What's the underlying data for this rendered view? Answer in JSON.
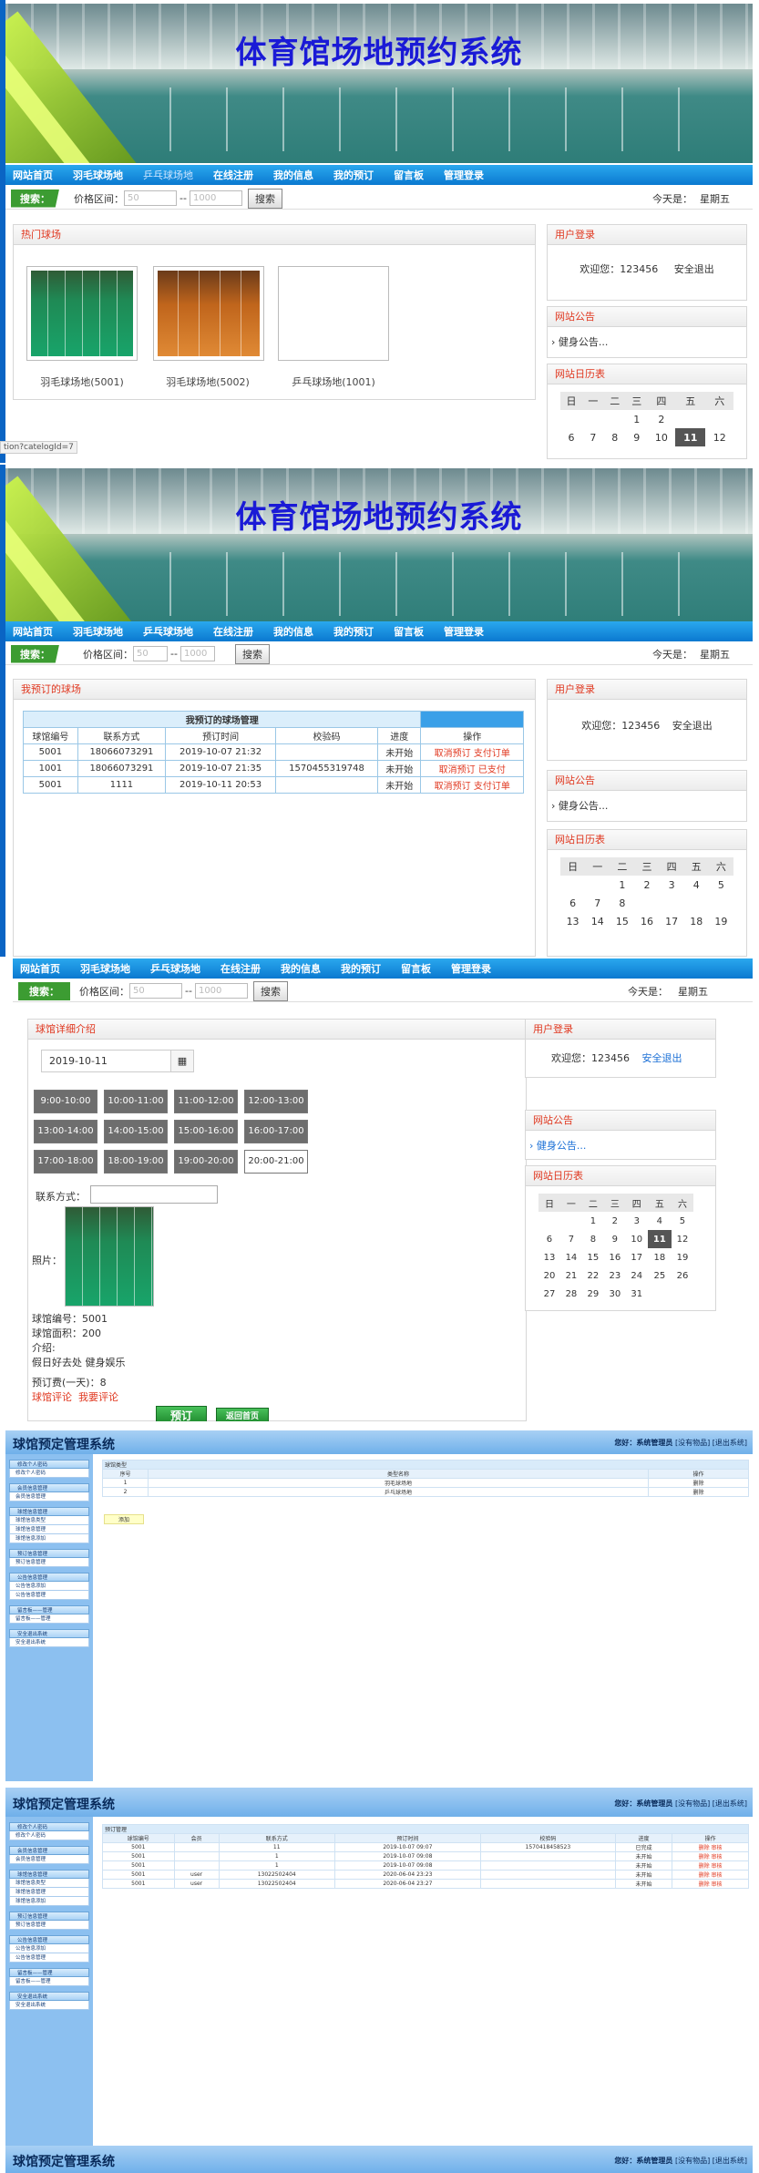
{
  "site_title": "体育馆场地预约系统",
  "nav": [
    "网站首页",
    "羽毛球场地",
    "乒乓球场地",
    "在线注册",
    "我的信息",
    "我的预订",
    "留言板",
    "管理登录"
  ],
  "search": {
    "label": "搜索：",
    "price_label": "价格区间：",
    "min": "50",
    "dash": "--",
    "max": "1000",
    "button": "搜索",
    "today_label": "今天是：",
    "weekday": "星期五"
  },
  "status_url": "tion?catelogId=7",
  "sidebar": {
    "login_title": "用户登录",
    "welcome": "欢迎您：123456",
    "logout": "安全退出",
    "notice_title": "网站公告",
    "notice_item": "健身公告...",
    "calendar_title": "网站日历表",
    "weekdays": [
      "日",
      "一",
      "二",
      "三",
      "四",
      "五",
      "六"
    ]
  },
  "panel1": {
    "section_title": "热门球场",
    "courts": [
      {
        "name": "羽毛球场地(5001)"
      },
      {
        "name": "羽毛球场地(5002)"
      },
      {
        "name": "乒乓球场地(1001)"
      }
    ],
    "cal_row1": [
      "",
      "",
      "",
      "1",
      "2",
      "",
      ""
    ],
    "cal_row2": [
      "6",
      "7",
      "8",
      "9",
      "10",
      "11",
      "12"
    ]
  },
  "panel2": {
    "section_title": "我预订的球场",
    "table_title": "我预订的球场管理",
    "headers": [
      "球馆编号",
      "联系方式",
      "预订时间",
      "校验码",
      "进度",
      "操作"
    ],
    "rows": [
      {
        "id": "5001",
        "phone": "18066073291",
        "time": "2019-10-07 21:32",
        "code": "",
        "status": "未开始",
        "ops": "取消预订 支付订单"
      },
      {
        "id": "1001",
        "phone": "18066073291",
        "time": "2019-10-07 21:35",
        "code": "1570455319748",
        "status": "未开始",
        "ops": "取消预订 已支付"
      },
      {
        "id": "5001",
        "phone": "1111",
        "time": "2019-10-11 20:53",
        "code": "",
        "status": "未开始",
        "ops": "取消预订 支付订单"
      }
    ],
    "cal_row1": [
      "",
      "",
      "",
      "1",
      "2",
      "3",
      "4",
      "5"
    ],
    "cal": [
      [
        "",
        "",
        "1",
        "2",
        "3",
        "4",
        "5"
      ],
      [
        "6",
        "7",
        "8",
        "",
        "",
        "",
        ""
      ],
      [
        "13",
        "14",
        "15",
        "16",
        "17",
        "18",
        "19"
      ]
    ]
  },
  "panel3": {
    "section_title": "球馆详细介绍",
    "date": "2019-10-11",
    "slots": [
      "9:00-10:00",
      "10:00-11:00",
      "11:00-12:00",
      "12:00-13:00",
      "13:00-14:00",
      "14:00-15:00",
      "15:00-16:00",
      "16:00-17:00",
      "17:00-18:00",
      "18:00-19:00",
      "19:00-20:00",
      "20:00-21:00"
    ],
    "contact_label": "联系方式：",
    "photo_label": "照片：",
    "venue_id": "球馆编号：5001",
    "area": "球馆面积：200",
    "intro_label": "介绍:",
    "intro": "假日好去处 健身娱乐",
    "fee": "预订费(一天)：8",
    "comment_links": "球馆评论  我要评论",
    "book_btn": "预订",
    "home_btn": "返回首页",
    "cal": [
      [
        "",
        "",
        "1",
        "2",
        "3",
        "4",
        "5"
      ],
      [
        "6",
        "7",
        "8",
        "9",
        "10",
        "11",
        "12"
      ],
      [
        "13",
        "14",
        "15",
        "16",
        "17",
        "18",
        "19"
      ],
      [
        "20",
        "21",
        "22",
        "23",
        "24",
        "25",
        "26"
      ],
      [
        "27",
        "28",
        "29",
        "30",
        "31",
        "",
        ""
      ]
    ]
  },
  "admin": {
    "title": "球馆预定管理系统",
    "greeting": "您好：系统管理员",
    "links": "[没有物品] [退出系统]",
    "menu": [
      {
        "group": "修改个人密码",
        "items": [
          "修改个人密码"
        ]
      },
      {
        "group": "会员信息管理",
        "items": [
          "会员信息管理"
        ]
      },
      {
        "group": "球馆信息管理",
        "items": [
          "球馆信息类型",
          "球馆信息管理",
          "球馆信息添加"
        ]
      },
      {
        "group": "预订信息管理",
        "items": [
          "预订信息管理"
        ]
      },
      {
        "group": "公告信息管理",
        "items": [
          "公告信息添加",
          "公告信息管理"
        ]
      },
      {
        "group": "留言板——管理",
        "items": [
          "留言板——管理"
        ]
      },
      {
        "group": "安全退出系统",
        "items": [
          "安全退出系统"
        ]
      }
    ],
    "type_table": {
      "title": "球馆类型",
      "headers": [
        "序号",
        "类型名称",
        "操作"
      ],
      "rows": [
        [
          "1",
          "羽毛球场地",
          "删除"
        ],
        [
          "2",
          "乒乓球场地",
          "删除"
        ]
      ],
      "add": "添加"
    },
    "book_table": {
      "title": "预订管理",
      "headers": [
        "球馆编号",
        "会员",
        "联系方式",
        "预订时间",
        "校验码",
        "进度",
        "操作"
      ],
      "rows": [
        [
          "5001",
          "",
          "11",
          "2019-10-07 09:07",
          "1570418458523",
          "已完成",
          "删除 审核"
        ],
        [
          "5001",
          "",
          "1",
          "2019-10-07 09:08",
          "",
          "未开始",
          "删除 审核"
        ],
        [
          "5001",
          "",
          "1",
          "2019-10-07 09:08",
          "",
          "未开始",
          "删除 审核"
        ],
        [
          "5001",
          "user",
          "13022502404",
          "2020-06-04 23:23",
          "",
          "未开始",
          "删除 审核"
        ],
        [
          "5001",
          "user",
          "13022502404",
          "2020-06-04 23:27",
          "",
          "未开始",
          "删除 审核"
        ]
      ]
    }
  }
}
